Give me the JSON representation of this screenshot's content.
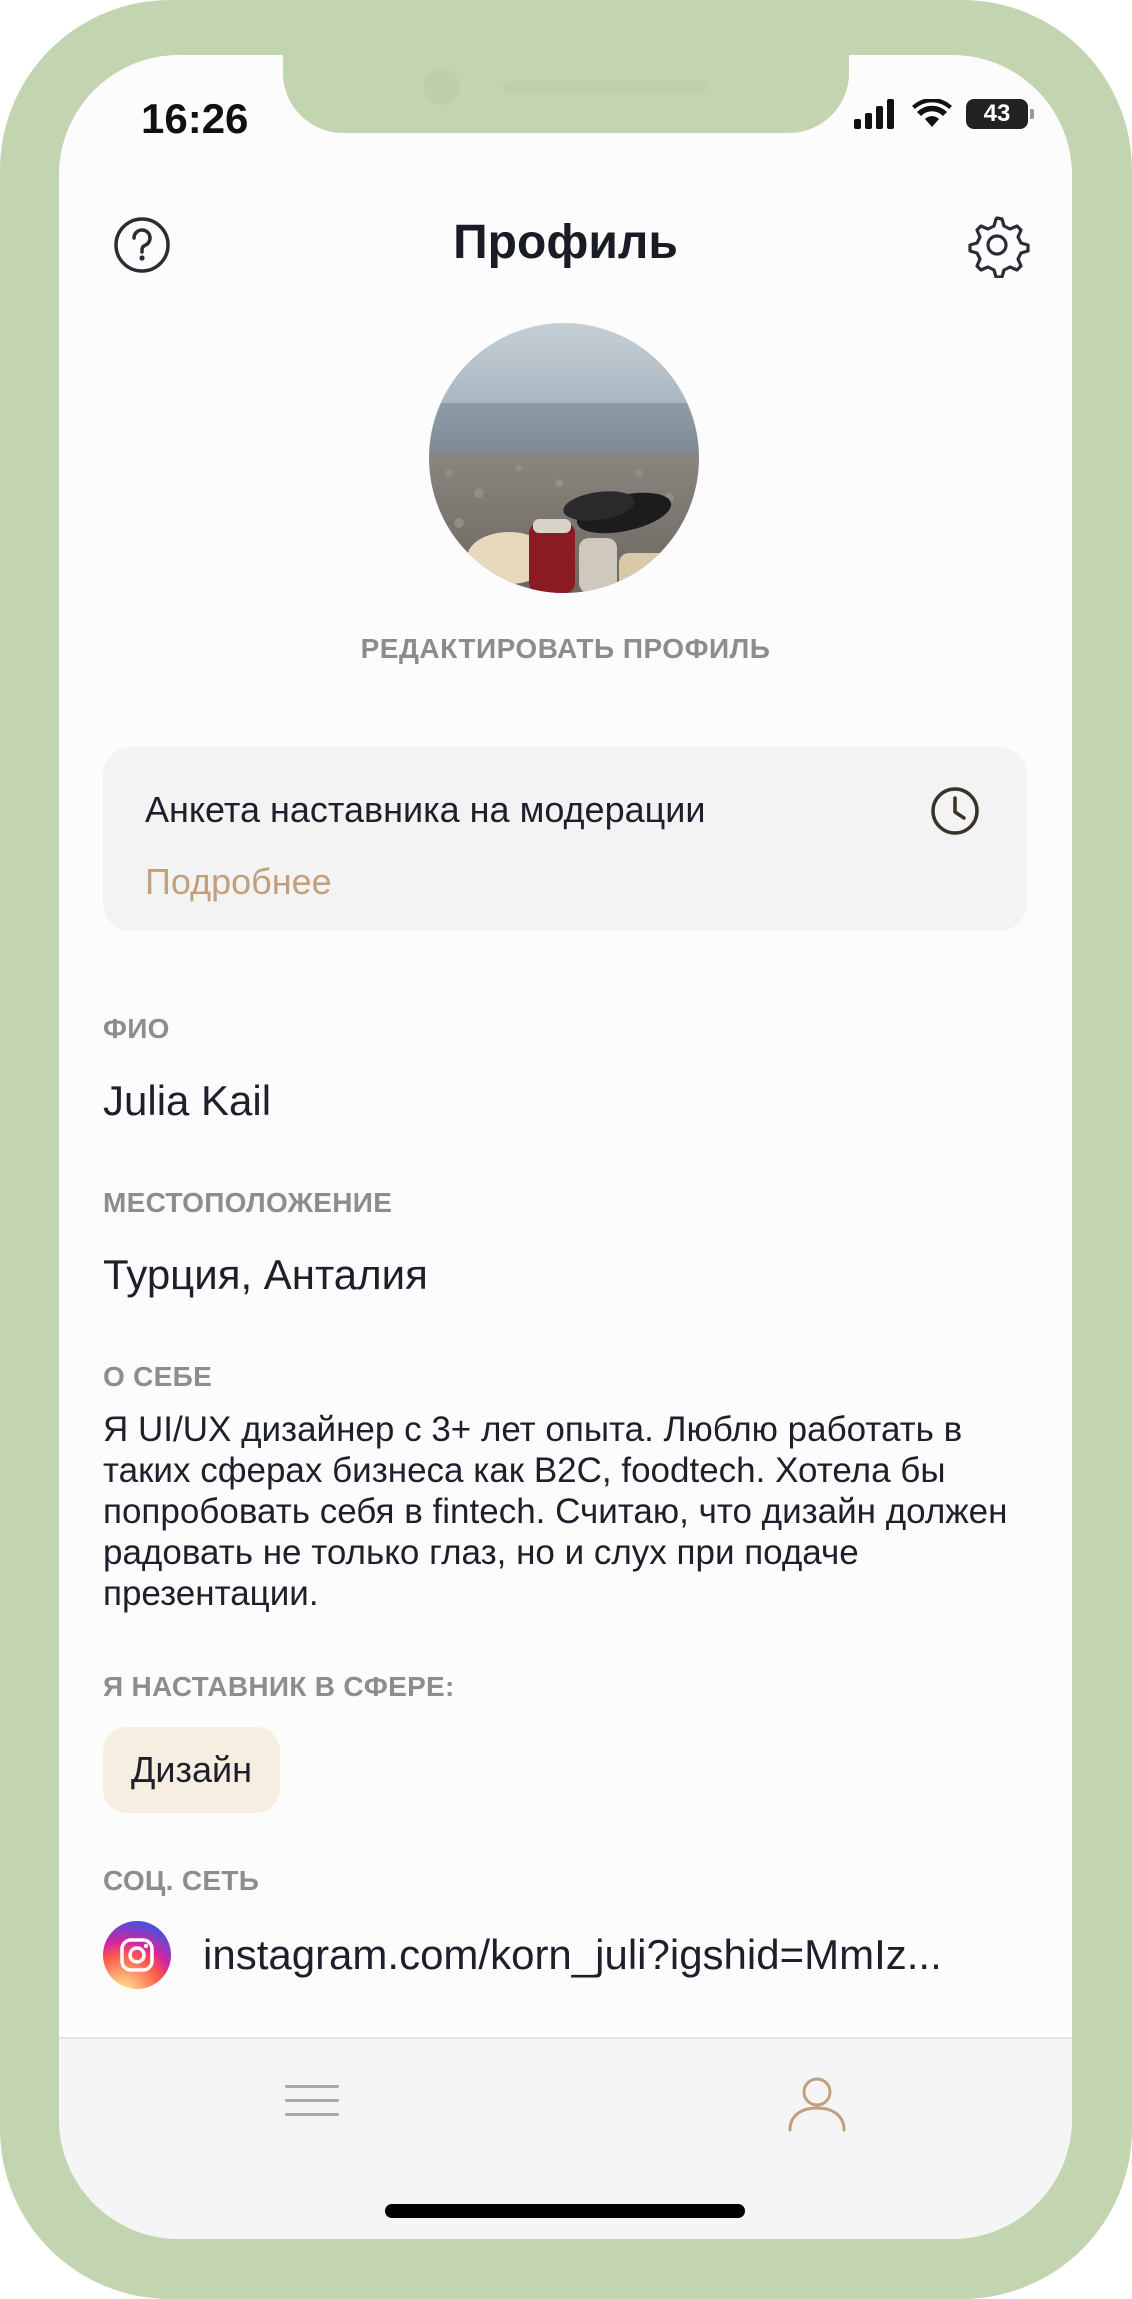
{
  "status_bar": {
    "time": "16:26",
    "battery": "43"
  },
  "header": {
    "title": "Профиль",
    "help_icon": "question-circle-icon",
    "settings_icon": "gear-icon"
  },
  "profile": {
    "edit_label": "РЕДАКТИРОВАТЬ ПРОФИЛЬ"
  },
  "moderation_card": {
    "title": "Анкета наставника на модерации",
    "more_link": "Подробнее",
    "icon": "clock-icon"
  },
  "fields": {
    "name_label": "ФИО",
    "name_value": "Julia  Kail",
    "location_label": "МЕСТОПОЛОЖЕНИЕ",
    "location_value": "Турция, Анталия",
    "about_label": "О СЕБЕ",
    "about_value": "Я UI/UX дизайнер с 3+ лет опыта. Люблю работать в таких сферах бизнеса как B2C, foodtech. Хотела бы попробовать себя в fintech. Считаю, что дизайн должен радовать не только глаз, но и слух при подаче презентации.",
    "mentor_label": "Я НАСТАВНИК В СФЕРЕ:",
    "mentor_chip": "Дизайн",
    "social_label": "СОЦ. СЕТЬ",
    "social_link": "instagram.com/korn_juli?igshid=MmIz..."
  },
  "tabbar": {
    "items": [
      {
        "icon": "menu-icon",
        "active": false
      },
      {
        "icon": "user-icon",
        "active": true
      }
    ]
  },
  "colors": {
    "frame": "#c3d5b0",
    "accent": "#c2a07c",
    "chip_bg": "#f7eee2",
    "card_bg": "#f3f3f4",
    "text": "#1d1f2a",
    "muted": "#8d8d8d"
  }
}
